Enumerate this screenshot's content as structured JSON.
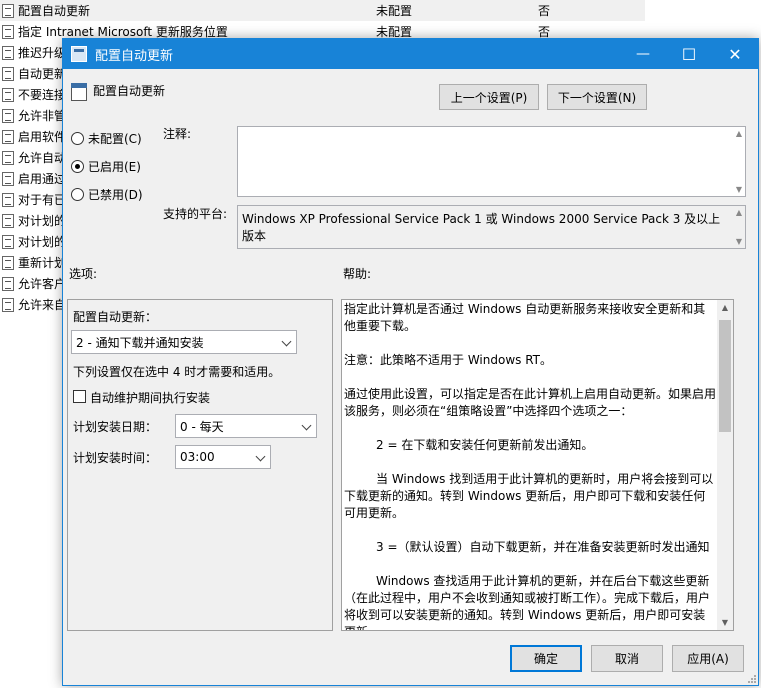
{
  "background": {
    "rows": [
      {
        "name": "配置自动更新",
        "state": "未配置",
        "comment": "否",
        "selected": true
      },
      {
        "name": "指定 Intranet Microsoft 更新服务位置",
        "state": "未配置",
        "comment": "否"
      },
      {
        "name": "推迟升级",
        "state": "",
        "comment": ""
      },
      {
        "name": "自动更新",
        "state": "",
        "comment": ""
      },
      {
        "name": "不要连接",
        "state": "",
        "comment": ""
      },
      {
        "name": "允许非管",
        "state": "",
        "comment": ""
      },
      {
        "name": "启用软件",
        "state": "",
        "comment": ""
      },
      {
        "name": "允许自动",
        "state": "",
        "comment": ""
      },
      {
        "name": "启用通过",
        "state": "",
        "comment": ""
      },
      {
        "name": "对于有已",
        "state": "",
        "comment": ""
      },
      {
        "name": "对计划的",
        "state": "",
        "comment": ""
      },
      {
        "name": "对计划的",
        "state": "",
        "comment": ""
      },
      {
        "name": "重新计划",
        "state": "",
        "comment": ""
      },
      {
        "name": "允许客户",
        "state": "",
        "comment": ""
      },
      {
        "name": "允许来自",
        "state": "",
        "comment": ""
      }
    ]
  },
  "dialog": {
    "title": "配置自动更新",
    "policy_title": "配置自动更新",
    "prev_button": "上一个设置(P)",
    "next_button": "下一个设置(N)",
    "radio_not_configured": "未配置(C)",
    "radio_enabled": "已启用(E)",
    "radio_disabled": "已禁用(D)",
    "selected_radio": "enabled",
    "comment_label": "注释:",
    "comment_value": "",
    "platform_label": "支持的平台:",
    "platform_value": "Windows XP Professional Service Pack 1 或 Windows 2000 Service Pack 3 及以上版本",
    "options_label": "选项:",
    "help_label": "帮助:",
    "ok_button": "确定",
    "cancel_button": "取消",
    "apply_button": "应用(A)"
  },
  "options": {
    "configure_label": "配置自动更新：",
    "configure_value": "2 - 通知下载并通知安装",
    "note": "下列设置仅在选中 4 时才需要和适用。",
    "maintenance_checkbox_label": "自动维护期间执行安装",
    "maintenance_checked": false,
    "day_label": "计划安装日期：",
    "day_value": "0 - 每天",
    "time_label": "计划安装时间：",
    "time_value": "03:00"
  },
  "help": {
    "paragraphs": [
      {
        "text": "指定此计算机是否通过 Windows 自动更新服务来接收安全更新和其他重要下载。",
        "indent": false
      },
      {
        "text": "注意：此策略不适用于 Windows RT。",
        "indent": false
      },
      {
        "text": "通过使用此设置，可以指定是否在此计算机上启用自动更新。如果启用该服务，则必须在“组策略设置”中选择四个选项之一：",
        "indent": false
      },
      {
        "text": "2 = 在下载和安装任何更新前发出通知。",
        "indent": true
      },
      {
        "text": "当 Windows 找到适用于此计算机的更新时，用户将会接到可以下载更新的通知。转到 Windows 更新后，用户即可下载和安装任何可用更新。",
        "indent": true
      },
      {
        "text": "3 =（默认设置）自动下载更新，并在准备安装更新时发出通知",
        "indent": true
      },
      {
        "text": "Windows 查找适用于此计算机的更新，并在后台下载这些更新（在此过程中，用户不会收到通知或被打断工作）。完成下载后，用户将收到可以安装更新的通知。转到 Windows 更新后，用户即可安装更新。",
        "indent": true
      }
    ]
  }
}
